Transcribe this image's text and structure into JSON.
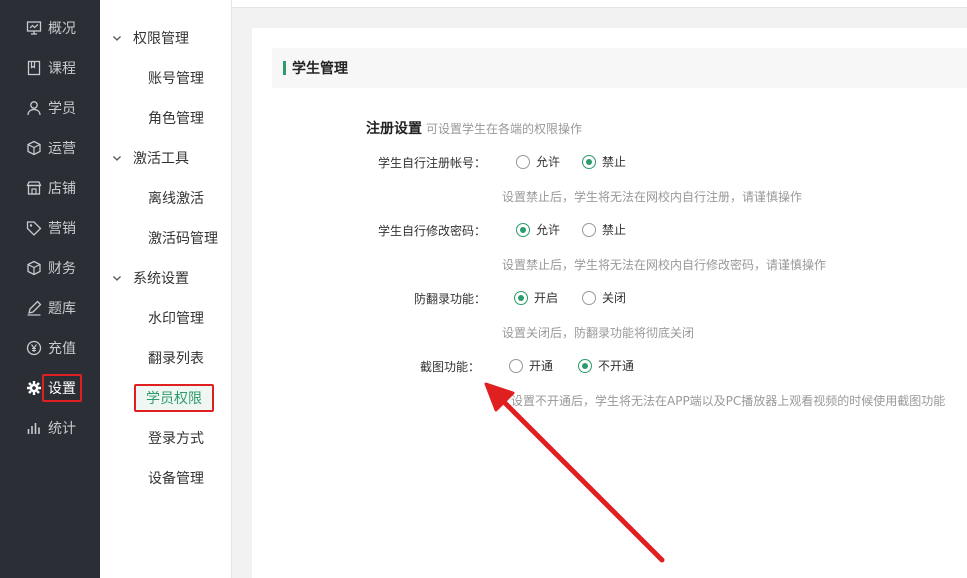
{
  "leftnav": {
    "items": [
      {
        "label": "概况",
        "icon": "monitor-icon"
      },
      {
        "label": "课程",
        "icon": "book-icon"
      },
      {
        "label": "学员",
        "icon": "user-icon"
      },
      {
        "label": "运营",
        "icon": "cube-icon"
      },
      {
        "label": "店铺",
        "icon": "store-icon"
      },
      {
        "label": "营销",
        "icon": "tag-icon"
      },
      {
        "label": "财务",
        "icon": "cube-icon"
      },
      {
        "label": "题库",
        "icon": "pen-icon"
      },
      {
        "label": "充值",
        "icon": "yen-icon"
      },
      {
        "label": "设置",
        "icon": "gear-icon"
      },
      {
        "label": "统计",
        "icon": "bar-chart-icon"
      }
    ],
    "active_index": 9
  },
  "subnav": {
    "groups": [
      {
        "label": "权限管理",
        "items": [
          "账号管理",
          "角色管理"
        ]
      },
      {
        "label": "激活工具",
        "items": [
          "离线激活",
          "激活码管理"
        ]
      },
      {
        "label": "系统设置",
        "items": [
          "水印管理",
          "翻录列表",
          "学员权限",
          "登录方式",
          "设备管理"
        ]
      }
    ],
    "active_item": "学员权限"
  },
  "card": {
    "title": "学生管理",
    "section_title": "注册设置",
    "section_hint": "可设置学生在各端的权限操作",
    "rows": [
      {
        "label": "学生自行注册帐号：",
        "options": [
          "允许",
          "禁止"
        ],
        "selected": 1,
        "note": "设置禁止后，学生将无法在网校内自行注册，请谨慎操作"
      },
      {
        "label": "学生自行修改密码：",
        "options": [
          "允许",
          "禁止"
        ],
        "selected": 0,
        "note": "设置禁止后，学生将无法在网校内自行修改密码，请谨慎操作"
      },
      {
        "label": "防翻录功能：",
        "options": [
          "开启",
          "关闭"
        ],
        "selected": 0,
        "note": "设置关闭后，防翻录功能将彻底关闭"
      },
      {
        "label": "截图功能：",
        "options": [
          "开通",
          "不开通"
        ],
        "selected": 1,
        "note": "设置不开通后，学生将无法在APP端以及PC播放器上观看视频的时候使用截图功能"
      }
    ]
  },
  "colors": {
    "accent": "#2d9b6b",
    "highlight": "#e02020",
    "nav_bg": "#2b2f35"
  }
}
